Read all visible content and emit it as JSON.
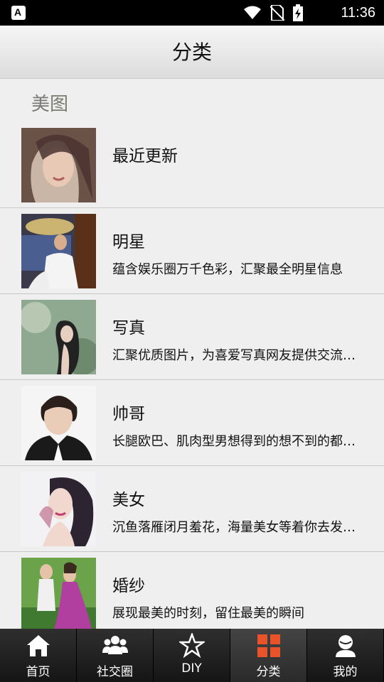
{
  "status_bar": {
    "time": "11:36",
    "app_badge": "A"
  },
  "header": {
    "title": "分类"
  },
  "section": {
    "title": "美图"
  },
  "items": [
    {
      "title": "最近更新",
      "subtitle": "",
      "thumb_icon": "woman-portrait-thumbnail"
    },
    {
      "title": "明星",
      "subtitle": "蕴含娱乐圈万千色彩，汇聚最全明星信息",
      "thumb_icon": "celebrity-thumbnail"
    },
    {
      "title": "写真",
      "subtitle": "汇聚优质图片，为喜爱写真网友提供交流…",
      "thumb_icon": "photoshoot-thumbnail"
    },
    {
      "title": "帅哥",
      "subtitle": "长腿欧巴、肌肉型男想得到的想不到的都…",
      "thumb_icon": "handsome-man-thumbnail"
    },
    {
      "title": "美女",
      "subtitle": "沉鱼落雁闭月羞花，海量美女等着你去发…",
      "thumb_icon": "beauty-thumbnail"
    },
    {
      "title": "婚纱",
      "subtitle": "展现最美的时刻，留住最美的瞬间",
      "thumb_icon": "wedding-thumbnail"
    }
  ],
  "tabs": [
    {
      "label": "首页",
      "icon": "home-icon"
    },
    {
      "label": "社交圈",
      "icon": "people-icon"
    },
    {
      "label": "DIY",
      "icon": "star-icon"
    },
    {
      "label": "分类",
      "icon": "grid-icon",
      "active": true
    },
    {
      "label": "我的",
      "icon": "user-icon"
    }
  ],
  "colors": {
    "active_icon": "#e8532a",
    "tab_bar": "#1f1f1f",
    "background": "#efefef"
  }
}
